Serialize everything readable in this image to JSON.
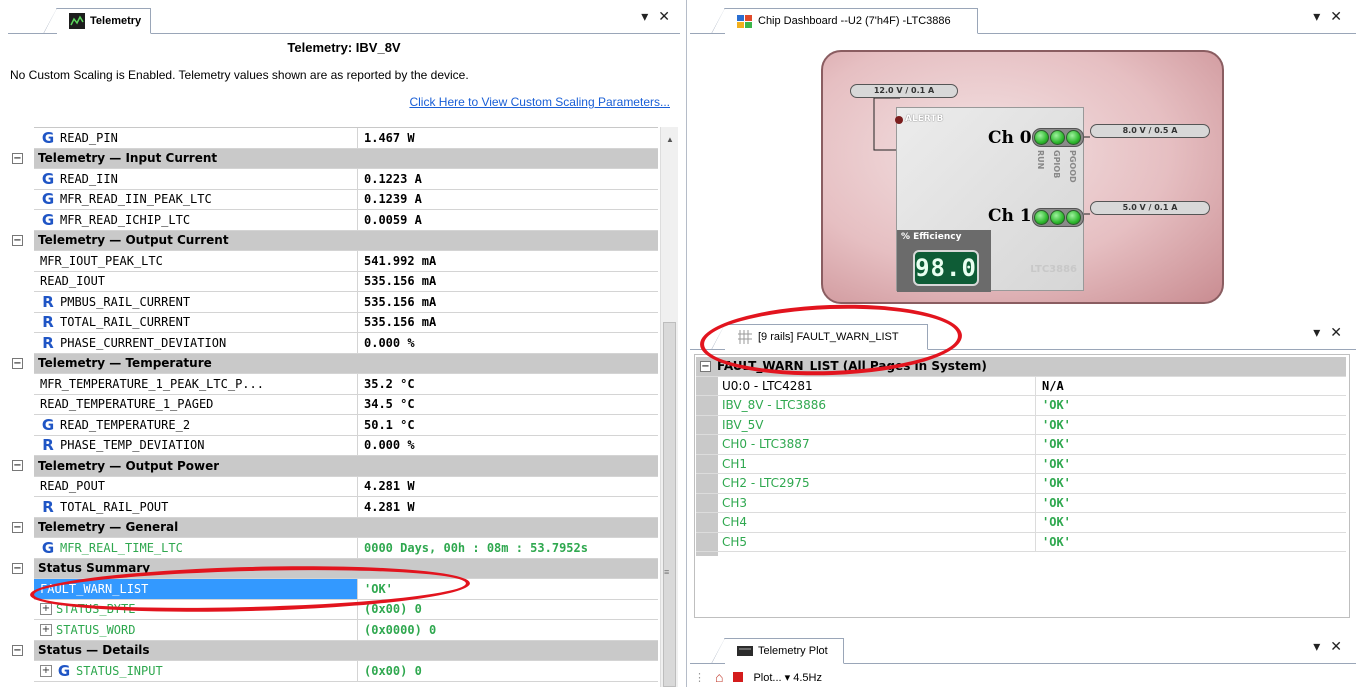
{
  "telemetry_panel": {
    "tab_label": "Telemetry",
    "header": "Telemetry: IBV_8V",
    "note": "No Custom Scaling is Enabled.  Telemetry values shown are as reported by the device.",
    "link": "Click Here to View Custom Scaling Parameters...",
    "rows": [
      {
        "type": "item",
        "icon": "G",
        "label": "READ_PIN",
        "value": "1.467 W"
      },
      {
        "type": "category",
        "label": "Telemetry — Input Current"
      },
      {
        "type": "item",
        "icon": "G",
        "label": "READ_IIN",
        "value": "0.1223 A"
      },
      {
        "type": "item",
        "icon": "G",
        "label": "MFR_READ_IIN_PEAK_LTC",
        "value": "0.1239 A"
      },
      {
        "type": "item",
        "icon": "G",
        "label": "MFR_READ_ICHIP_LTC",
        "value": "0.0059 A"
      },
      {
        "type": "category",
        "label": "Telemetry — Output Current"
      },
      {
        "type": "item",
        "icon": "",
        "label": "MFR_IOUT_PEAK_LTC",
        "value": "541.992 mA"
      },
      {
        "type": "item",
        "icon": "",
        "label": "READ_IOUT",
        "value": "535.156 mA"
      },
      {
        "type": "item",
        "icon": "R",
        "label": "PMBUS_RAIL_CURRENT",
        "value": "535.156 mA"
      },
      {
        "type": "item",
        "icon": "R",
        "label": "TOTAL_RAIL_CURRENT",
        "value": "535.156 mA"
      },
      {
        "type": "item",
        "icon": "R",
        "label": "PHASE_CURRENT_DEVIATION",
        "value": "0.000 %"
      },
      {
        "type": "category",
        "label": "Telemetry — Temperature"
      },
      {
        "type": "item",
        "icon": "",
        "label": "MFR_TEMPERATURE_1_PEAK_LTC_P...",
        "value": "35.2 °C"
      },
      {
        "type": "item",
        "icon": "",
        "label": "READ_TEMPERATURE_1_PAGED",
        "value": "34.5 °C"
      },
      {
        "type": "item",
        "icon": "G",
        "label": "READ_TEMPERATURE_2",
        "value": "50.1 °C"
      },
      {
        "type": "item",
        "icon": "R",
        "label": "PHASE_TEMP_DEVIATION",
        "value": "0.000 %"
      },
      {
        "type": "category",
        "label": "Telemetry — Output Power"
      },
      {
        "type": "item",
        "icon": "",
        "label": "READ_POUT",
        "value": "4.281 W"
      },
      {
        "type": "item",
        "icon": "R",
        "label": "TOTAL_RAIL_POUT",
        "value": "4.281 W"
      },
      {
        "type": "category",
        "label": "Telemetry — General"
      },
      {
        "type": "item",
        "icon": "G",
        "label": "MFR_REAL_TIME_LTC",
        "value": "0000 Days, 00h : 08m : 53.7952s",
        "green": true
      },
      {
        "type": "category",
        "label": "Status Summary"
      },
      {
        "type": "item",
        "icon": "",
        "label": "FAULT_WARN_LIST",
        "value": "'OK'",
        "selected": true
      },
      {
        "type": "item",
        "icon": "",
        "expand": true,
        "label": "STATUS_BYTE",
        "value": "(0x00) 0",
        "green": true
      },
      {
        "type": "item",
        "icon": "",
        "expand": true,
        "label": "STATUS_WORD",
        "value": "(0x0000) 0",
        "green": true
      },
      {
        "type": "category",
        "label": "Status — Details"
      },
      {
        "type": "item",
        "icon": "G",
        "expand": true,
        "label": "STATUS_INPUT",
        "value": "(0x00) 0",
        "green": true
      }
    ]
  },
  "chip_dashboard": {
    "tab_label": "Chip Dashboard --U2 (7'h4F) -LTC3886",
    "input_pill": "12.0 V / 0.1 A",
    "ch0_pill": "8.0 V / 0.5 A",
    "ch1_pill": "5.0 V / 0.1 A",
    "alert_label": "ALERTB",
    "ch0_label": "Ch 0",
    "ch1_label": "Ch 1",
    "run_label": "RUN",
    "gpio_label": "GPIOB",
    "pgood_label": "PGOOD",
    "efficiency_label": "% Efficiency",
    "efficiency_value": "98.0",
    "part_label": "LTC3886"
  },
  "fault_panel": {
    "tab_label": "[9 rails] FAULT_WARN_LIST",
    "category": "FAULT_WARN_LIST (All Pages in System)",
    "rows": [
      {
        "label": "U0:0 - LTC4281",
        "value": "N/A",
        "green": false
      },
      {
        "label": "IBV_8V - LTC3886",
        "value": "'OK'",
        "green": true
      },
      {
        "label": "IBV_5V",
        "value": "'OK'",
        "green": true
      },
      {
        "label": "CH0 - LTC3887",
        "value": "'OK'",
        "green": true
      },
      {
        "label": "CH1",
        "value": "'OK'",
        "green": true
      },
      {
        "label": "CH2 - LTC2975",
        "value": "'OK'",
        "green": true
      },
      {
        "label": "CH3",
        "value": "'OK'",
        "green": true
      },
      {
        "label": "CH4",
        "value": "'OK'",
        "green": true
      },
      {
        "label": "CH5",
        "value": "'OK'",
        "green": true
      }
    ]
  },
  "plot_panel": {
    "tab_label": "Telemetry Plot",
    "plot_dropdown": "Plot...",
    "rate": "4.5Hz"
  },
  "window_controls": {
    "pin": "▾",
    "close": "✕"
  },
  "colors": {
    "accent": "#3399ff",
    "ok_green": "#2fa84f",
    "category": "#c9c9c9",
    "annotation": "#e2141e"
  }
}
